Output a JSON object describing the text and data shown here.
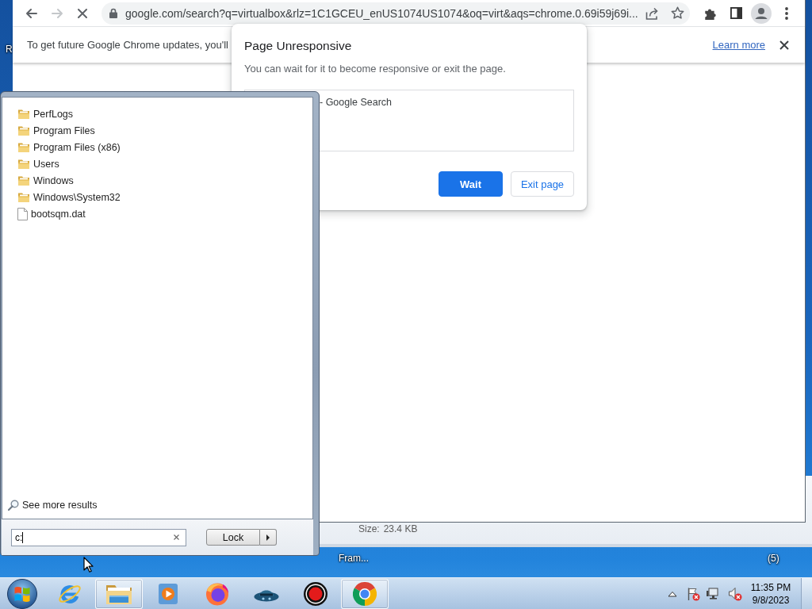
{
  "desktop": {
    "labels": [
      {
        "text": "R"
      },
      {
        "text": "Fram..."
      },
      {
        "text": "(5)"
      }
    ]
  },
  "chrome": {
    "toolbar": {
      "nav": [
        {
          "kind": "back",
          "disabled": false
        },
        {
          "kind": "forward",
          "disabled": true
        },
        {
          "kind": "stop",
          "disabled": false
        }
      ],
      "url": "google.com/search?q=virtualbox&rlz=1C1GCEU_enUS1074US1074&oq=virt&aqs=chrome.0.69i59j69i...",
      "address_actions": [
        {
          "kind": "share"
        },
        {
          "kind": "star"
        }
      ],
      "actions": [
        {
          "kind": "extensions"
        },
        {
          "kind": "side-panel"
        },
        {
          "kind": "profile"
        },
        {
          "kind": "menu"
        }
      ]
    },
    "infobar": {
      "message": "To get future Google Chrome updates, you'll",
      "link": "Learn more"
    }
  },
  "dialog": {
    "title": "Page Unresponsive",
    "message": "You can wait for it to become responsive or exit the page.",
    "pages": [
      "- Google Search"
    ],
    "buttons": [
      {
        "label": "Wait",
        "kind": "primary"
      },
      {
        "label": "Exit page",
        "kind": "secondary"
      }
    ]
  },
  "details_pane": {
    "label": "Size:",
    "value": "23.4 KB"
  },
  "start_menu": {
    "results": [
      {
        "name": "PerfLogs",
        "kind": "folder",
        "selected": false
      },
      {
        "name": "Program Files",
        "kind": "folder",
        "selected": false
      },
      {
        "name": "Program Files (x86)",
        "kind": "folder",
        "selected": false
      },
      {
        "name": "Users",
        "kind": "folder",
        "selected": false
      },
      {
        "name": "Windows",
        "kind": "folder",
        "selected": false
      },
      {
        "name": "Windows\\System32",
        "kind": "folder",
        "selected": false
      },
      {
        "name": "bootsqm.dat",
        "kind": "file",
        "selected": false
      }
    ],
    "see_more": "See more results",
    "search": {
      "value": "c:"
    },
    "power_button": "Lock"
  },
  "taskbar": {
    "items": [
      {
        "kind": "ie",
        "open": false
      },
      {
        "kind": "explorer",
        "open": true
      },
      {
        "kind": "media",
        "open": false
      },
      {
        "kind": "firefox",
        "open": false
      },
      {
        "kind": "hat",
        "open": false
      },
      {
        "kind": "record",
        "open": false
      },
      {
        "kind": "chrome",
        "open": true
      }
    ],
    "tray": [
      {
        "kind": "show-hidden",
        "error": false
      },
      {
        "kind": "flag",
        "error": true
      },
      {
        "kind": "network",
        "error": false
      },
      {
        "kind": "volume",
        "error": true
      }
    ],
    "clock": {
      "time": "11:35 PM",
      "date": "9/8/2023"
    }
  }
}
